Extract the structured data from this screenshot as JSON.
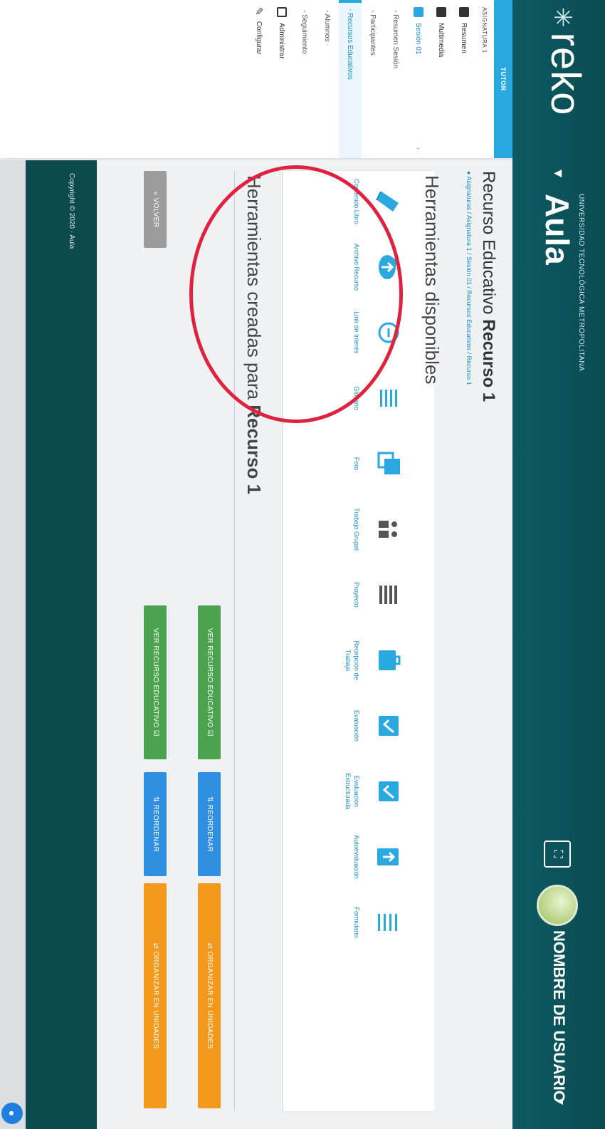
{
  "header": {
    "logo": "reko",
    "university": "UNIVERSIDAD TECNOLÓGICA METROPOLITANA",
    "app": "Aula",
    "username": "NOMBRE DE USUARIO"
  },
  "sidebar": {
    "tutor": "TUTOR",
    "subject_heading": "ASIGNATURA 1",
    "items": [
      {
        "label": "Resumen"
      },
      {
        "label": "Multimedia"
      },
      {
        "label": "Sesión 01"
      },
      {
        "label": "- Resumen Sesión"
      },
      {
        "label": "- Participantes"
      },
      {
        "label": "- Recursos Educativos"
      },
      {
        "label": "- Alumnos"
      },
      {
        "label": "- Seguimiento"
      },
      {
        "label": "Administrar"
      },
      {
        "label": "Configurar"
      }
    ]
  },
  "main": {
    "title_prefix": "Recurso Educativo",
    "title_bold": "Recurso 1",
    "breadcrumb": "Asignaturas / Asignatura 1 / Sesión 01 / Recursos Educativos / Recurso 1",
    "available_title": "Herramientas disponibles",
    "tools": [
      {
        "label": "Contenido Libro",
        "icon": "book-icon"
      },
      {
        "label": "Archivo Recurso",
        "icon": "cloud-upload-icon"
      },
      {
        "label": "Link de Interés",
        "icon": "link-icon"
      },
      {
        "label": "Glosario",
        "icon": "list-icon"
      },
      {
        "label": "Foro",
        "icon": "forum-icon"
      },
      {
        "label": "Trabajo Grupal",
        "icon": "group-icon"
      },
      {
        "label": "Proyecto",
        "icon": "grid-icon"
      },
      {
        "label": "Recepción de Trabajo",
        "icon": "briefcase-icon"
      },
      {
        "label": "Evaluación",
        "icon": "check-clipboard-icon"
      },
      {
        "label": "Evaluación Estructurada",
        "icon": "check-box-icon"
      },
      {
        "label": "Autoevaluación",
        "icon": "clipboard-up-icon"
      },
      {
        "label": "Formulario",
        "icon": "form-list-icon"
      }
    ],
    "created_prefix": "Herramientas creadas para",
    "created_bold": "Recurso 1",
    "rows": [
      {
        "view": "VER RECURSO EDUCATIVO",
        "reorder": "REORDENAR",
        "organize": "ORGANIZAR EN UNIDADES"
      },
      {
        "view": "VER RECURSO EDUCATIVO",
        "reorder": "REORDENAR",
        "organize": "ORGANIZAR EN UNIDADES"
      }
    ],
    "back": "« VOLVER"
  },
  "footer": {
    "text": "Copyright © 2020 · Aula"
  },
  "colors": {
    "header": "#0b4b52",
    "accent": "#29a9e0",
    "annotation": "#e0223f"
  }
}
